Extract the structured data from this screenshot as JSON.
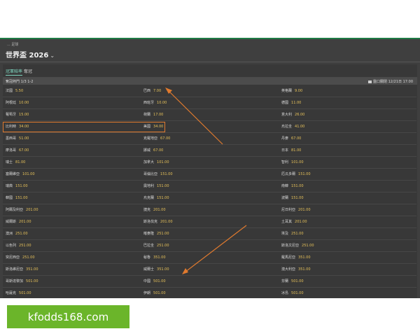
{
  "header": {
    "breadcrumb": "... 足球",
    "title": "世界盃 2026"
  },
  "tabs": [
    "冠軍賠率",
    "奪冠"
  ],
  "subheader": {
    "left": "奪冠熱門 1/3 1-2",
    "right": "盤口關閉 12/21日 17:00"
  },
  "teams": [
    {
      "name": "法國",
      "odds": "5.50"
    },
    {
      "name": "巴西",
      "odds": "7.00"
    },
    {
      "name": "英格蘭",
      "odds": "9.00"
    },
    {
      "name": "阿根廷",
      "odds": "10.00"
    },
    {
      "name": "西班牙",
      "odds": "10.00"
    },
    {
      "name": "德國",
      "odds": "11.00"
    },
    {
      "name": "葡萄牙",
      "odds": "15.00"
    },
    {
      "name": "荷蘭",
      "odds": "17.00"
    },
    {
      "name": "意大利",
      "odds": "26.00"
    },
    {
      "name": "比利時",
      "odds": "34.00"
    },
    {
      "name": "美國",
      "odds": "34.00"
    },
    {
      "name": "烏拉圭",
      "odds": "41.00"
    },
    {
      "name": "墨西哥",
      "odds": "51.00"
    },
    {
      "name": "克羅地亞",
      "odds": "67.00"
    },
    {
      "name": "丹麥",
      "odds": "67.00"
    },
    {
      "name": "摩洛哥",
      "odds": "67.00"
    },
    {
      "name": "挪威",
      "odds": "67.00"
    },
    {
      "name": "日本",
      "odds": "81.00"
    },
    {
      "name": "瑞士",
      "odds": "81.00"
    },
    {
      "name": "加拿大",
      "odds": "101.00"
    },
    {
      "name": "智利",
      "odds": "101.00"
    },
    {
      "name": "塞爾維亞",
      "odds": "101.00"
    },
    {
      "name": "哥倫比亞",
      "odds": "151.00"
    },
    {
      "name": "厄瓜多爾",
      "odds": "151.00"
    },
    {
      "name": "瑞典",
      "odds": "151.00"
    },
    {
      "name": "奧地利",
      "odds": "151.00"
    },
    {
      "name": "南韓",
      "odds": "151.00"
    },
    {
      "name": "韓國",
      "odds": "151.00"
    },
    {
      "name": "烏克蘭",
      "odds": "151.00"
    },
    {
      "name": "波蘭",
      "odds": "151.00"
    },
    {
      "name": "阿爾及利亞",
      "odds": "201.00"
    },
    {
      "name": "捷克",
      "odds": "201.00"
    },
    {
      "name": "尼日利亞",
      "odds": "201.00"
    },
    {
      "name": "威爾斯",
      "odds": "201.00"
    },
    {
      "name": "斯洛伐克",
      "odds": "201.00"
    },
    {
      "name": "土耳其",
      "odds": "201.00"
    },
    {
      "name": "澳洲",
      "odds": "251.00"
    },
    {
      "name": "喀麥隆",
      "odds": "251.00"
    },
    {
      "name": "埃及",
      "odds": "251.00"
    },
    {
      "name": "以色列",
      "odds": "251.00"
    },
    {
      "name": "巴拉圭",
      "odds": "251.00"
    },
    {
      "name": "斯洛文尼亞",
      "odds": "251.00"
    },
    {
      "name": "突尼西亞",
      "odds": "251.00"
    },
    {
      "name": "秘魯",
      "odds": "351.00"
    },
    {
      "name": "羅馬尼亞",
      "odds": "351.00"
    },
    {
      "name": "斯洛維尼亞",
      "odds": "351.00"
    },
    {
      "name": "威爾士",
      "odds": "351.00"
    },
    {
      "name": "澳大利亞",
      "odds": "351.00"
    },
    {
      "name": "哥斯達黎加",
      "odds": "501.00"
    },
    {
      "name": "中國",
      "odds": "501.00"
    },
    {
      "name": "芬蘭",
      "odds": "501.00"
    },
    {
      "name": "哈薩克",
      "odds": "501.00"
    },
    {
      "name": "伊朗",
      "odds": "501.00"
    },
    {
      "name": "冰島",
      "odds": "501.00"
    }
  ],
  "footer": {
    "text": "kfodds168.com"
  },
  "colors": {
    "highlight": "#e07a2e",
    "odds": "#e6c15a",
    "accent": "#7fd6c0",
    "footer_bg": "#6bb52a"
  }
}
